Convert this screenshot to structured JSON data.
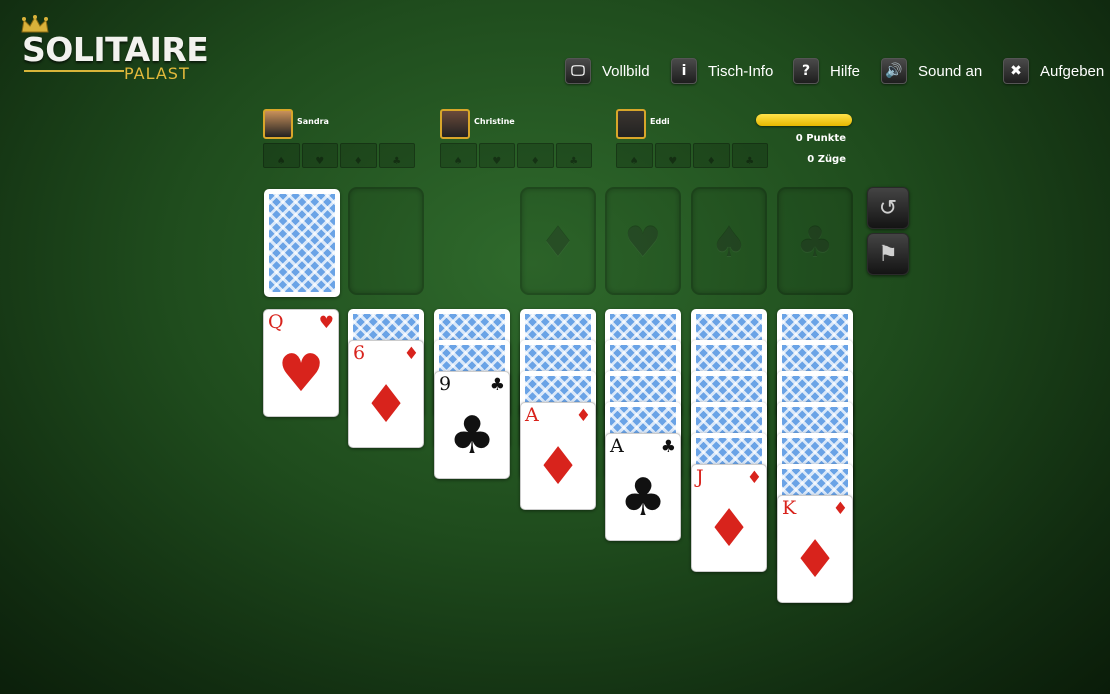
{
  "logo": {
    "title": "SOLITAIRE",
    "subtitle": "PALAST",
    "crown_icon": "crown-icon"
  },
  "menu": [
    {
      "label": "Vollbild",
      "icon": "monitor-icon",
      "glyph": "🖵"
    },
    {
      "label": "Tisch-Info",
      "icon": "info-icon",
      "glyph": "i"
    },
    {
      "label": "Hilfe",
      "icon": "help-icon",
      "glyph": "?"
    },
    {
      "label": "Sound an",
      "icon": "speaker-icon",
      "glyph": "🔊"
    },
    {
      "label": "Aufgeben",
      "icon": "close-icon",
      "glyph": "✖"
    }
  ],
  "players": [
    {
      "name": "Sandra",
      "avatar_color": "#c9915a"
    },
    {
      "name": "Christine",
      "avatar_color": "#6b4a3a"
    },
    {
      "name": "Eddi",
      "avatar_color": "#3c3530"
    }
  ],
  "suits_row": [
    "♠",
    "♥",
    "♦",
    "♣"
  ],
  "score": {
    "points": "0 Punkte",
    "moves": "0 Züge",
    "progress": 1.0
  },
  "colors": {
    "table_green": "#1f4c1d",
    "card_back_blue": "#6aa3e6",
    "red_suit": "#d8231c",
    "progress_yellow": "#ffe24a"
  },
  "stock": {
    "type": "face-down"
  },
  "foundations": [
    {
      "empty": true,
      "symbol": ""
    },
    {
      "empty": true,
      "symbol": "♦"
    },
    {
      "empty": true,
      "symbol": "♥"
    },
    {
      "empty": true,
      "symbol": "♠"
    },
    {
      "empty": true,
      "symbol": "♣"
    }
  ],
  "tableau": [
    {
      "face_down": 0,
      "top_card": {
        "rank": "Q",
        "suit": "♥",
        "color": "red"
      }
    },
    {
      "face_down": 1,
      "top_card": {
        "rank": "6",
        "suit": "♦",
        "color": "red"
      }
    },
    {
      "face_down": 2,
      "top_card": {
        "rank": "9",
        "suit": "♣",
        "color": "black"
      }
    },
    {
      "face_down": 3,
      "top_card": {
        "rank": "A",
        "suit": "♦",
        "color": "red"
      }
    },
    {
      "face_down": 4,
      "top_card": {
        "rank": "A",
        "suit": "♣",
        "color": "black"
      }
    },
    {
      "face_down": 5,
      "top_card": {
        "rank": "J",
        "suit": "♦",
        "color": "red"
      }
    },
    {
      "face_down": 6,
      "top_card": {
        "rank": "K",
        "suit": "♦",
        "color": "red"
      }
    }
  ],
  "controls": [
    {
      "name": "undo",
      "icon": "undo-icon",
      "glyph": "↺"
    },
    {
      "name": "flag",
      "icon": "flag-icon",
      "glyph": "⚑"
    }
  ]
}
